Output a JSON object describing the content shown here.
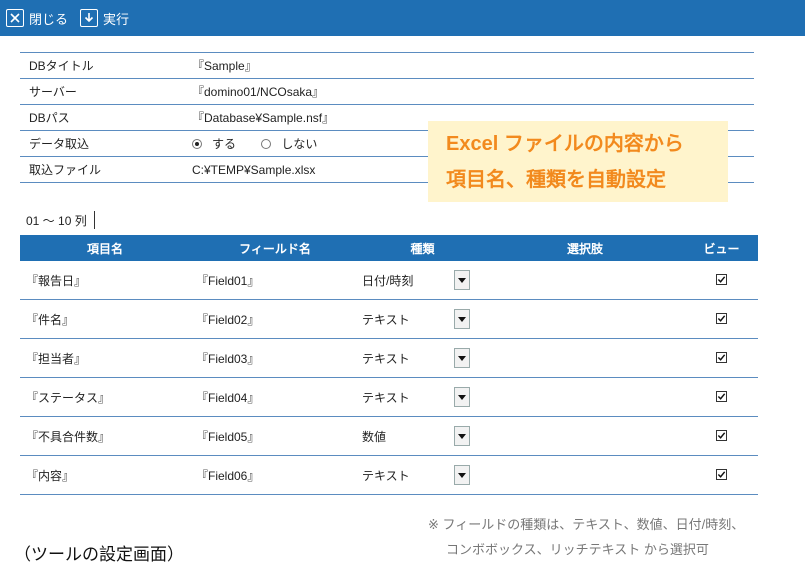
{
  "toolbar": {
    "close_label": "閉じる",
    "run_label": "実行"
  },
  "info": {
    "rows": [
      {
        "label": "DBタイトル",
        "value": "『Sample』"
      },
      {
        "label": "サーバー",
        "value": "『domino01/NCOsaka』"
      },
      {
        "label": "DBパス",
        "value": "『Database¥Sample.nsf』"
      },
      {
        "label": "データ取込",
        "radio_on": "する",
        "radio_off": "しない"
      },
      {
        "label": "取込ファイル",
        "value": "C:¥TEMP¥Sample.xlsx"
      }
    ]
  },
  "callout": {
    "line1": "Excel ファイルの内容から",
    "line2": "項目名、種類を自動設定"
  },
  "range_label": "01 ～ 10 列",
  "grid": {
    "headers": [
      "項目名",
      "フィールド名",
      "種類",
      "選択肢",
      "ビュー"
    ],
    "rows": [
      {
        "item": "『報告日』",
        "field": "『Field01』",
        "type": "日付/時刻",
        "view": true
      },
      {
        "item": "『件名』",
        "field": "『Field02』",
        "type": "テキスト",
        "view": true
      },
      {
        "item": "『担当者』",
        "field": "『Field03』",
        "type": "テキスト",
        "view": true
      },
      {
        "item": "『ステータス』",
        "field": "『Field04』",
        "type": "テキスト",
        "view": true
      },
      {
        "item": "『不具合件数』",
        "field": "『Field05』",
        "type": "数値",
        "view": true
      },
      {
        "item": "『内容』",
        "field": "『Field06』",
        "type": "テキスト",
        "view": true
      }
    ]
  },
  "note": {
    "line1": "※ フィールドの種類は、テキスト、数値、日付/時刻、",
    "line2": "コンボボックス、リッチテキスト から選択可"
  },
  "caption": "（ツールの設定画面）",
  "colors": {
    "toolbar": "#1f6fb3",
    "callout_text": "#f28a1e",
    "callout_bg": "#fff4cc"
  }
}
